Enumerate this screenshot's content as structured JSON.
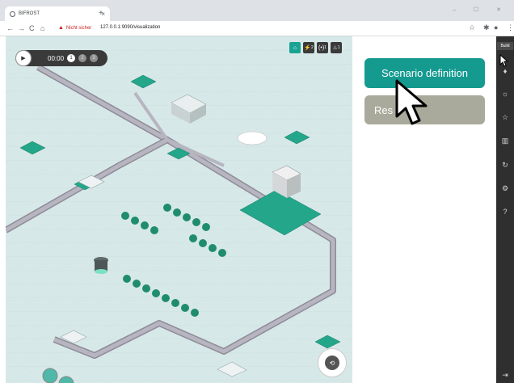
{
  "browser": {
    "tab_title": "BIFROST",
    "tab_close": "×",
    "new_tab": "+",
    "window_controls": "– ☐ ✕",
    "security_label": "Nicht sicher",
    "url": "127.0.0.1:9090/visualization",
    "nav": {
      "back": "←",
      "forward": "→",
      "reload": "C",
      "home": "⌂"
    }
  },
  "player": {
    "play_symbol": "▶",
    "time": "00:00",
    "speeds": [
      "1",
      "2",
      "3"
    ]
  },
  "layers": [
    "⌂",
    "⚡",
    "(•)",
    "♨"
  ],
  "layer_subs": [
    "",
    "2",
    "1",
    "1"
  ],
  "panel": {
    "scenario_button": "Scenario definition",
    "results_button": "Res"
  },
  "sidebar": {
    "build_label": "Build",
    "icons": [
      "pointer-icon",
      "lightbulb-icon",
      "sun-icon",
      "star-icon",
      "factory-icon",
      "gear-loop-icon",
      "settings-icon",
      "help-icon",
      "exit-icon"
    ],
    "icon_glyphs": [
      "☝",
      "♦",
      "☼",
      "☆",
      "▥",
      "↻",
      "⚙",
      "?",
      "⇥"
    ]
  },
  "colors": {
    "accent": "#159a90",
    "results": "#a9aa9b",
    "ground": "#d7e8e8",
    "road": "#a9a7b2",
    "sidebar": "#2f2f2f"
  }
}
